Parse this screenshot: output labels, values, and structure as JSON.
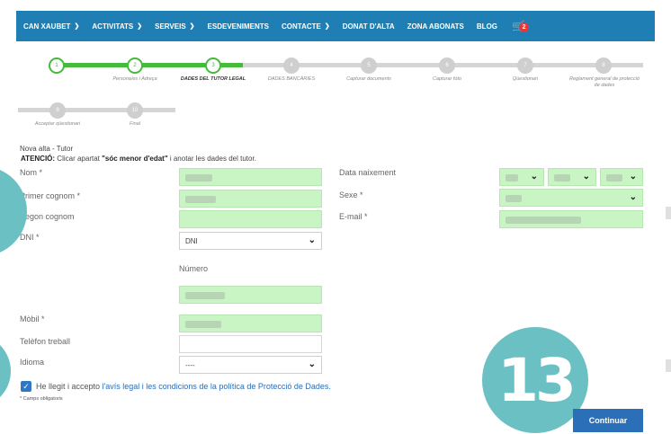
{
  "nav": {
    "items": [
      {
        "label": "CAN XAUBET",
        "dropdown": true
      },
      {
        "label": "ACTIVITATS",
        "dropdown": true
      },
      {
        "label": "SERVEIS",
        "dropdown": true
      },
      {
        "label": "ESDEVENIMENTS",
        "dropdown": false
      },
      {
        "label": "CONTACTE",
        "dropdown": true
      },
      {
        "label": "DONAT D'ALTA",
        "dropdown": false
      },
      {
        "label": "ZONA ABONATS",
        "dropdown": false
      },
      {
        "label": "BLOG",
        "dropdown": false
      }
    ],
    "cart_icon": "shopping-cart-icon",
    "cart_count": "2"
  },
  "steps": [
    {
      "number": "1",
      "label": "",
      "status": "done"
    },
    {
      "number": "2",
      "label": "Persona/es i Adreça",
      "status": "done"
    },
    {
      "number": "3",
      "label": "DADES DEL TUTOR LEGAL",
      "status": "active"
    },
    {
      "number": "4",
      "label": "DADES BANCÀRIES",
      "status": "todo"
    },
    {
      "number": "5",
      "label": "Capturar documents",
      "status": "todo"
    },
    {
      "number": "6",
      "label": "Capturar foto",
      "status": "todo"
    },
    {
      "number": "7",
      "label": "Qüestionari",
      "status": "todo"
    },
    {
      "number": "8",
      "label": "Reglament general de protecció de dades",
      "status": "todo"
    },
    {
      "number": "9",
      "label": "Acceptar qüestionari",
      "status": "todo"
    },
    {
      "number": "10",
      "label": "Final",
      "status": "todo"
    }
  ],
  "form": {
    "small_title": "Nova alta - Tutor",
    "atencio_prefix": "ATENCIÓ:",
    "atencio_text": " Clicar apartat ",
    "atencio_bold": "\"sóc menor d'edat\"",
    "atencio_suffix": " i anotar les dades del tutor.",
    "labels": {
      "nom": "Nom *",
      "primer_cognom": "Primer cognom *",
      "segon_cognom": "Segon cognom",
      "dni": "DNI *",
      "numero": "Número",
      "mobil": "Mòbil *",
      "telefon_treball": "Telèfon treball",
      "idioma": "Idioma",
      "data_naixement": "Data naixement",
      "sexe": "Sexe *",
      "email": "E-mail *"
    },
    "dni_type": "DNI",
    "idioma_value": "----",
    "legal_prefix": "He llegit i accepto ",
    "legal_link": "l'avís legal i les condicions de la política de Protecció de Dades.",
    "required_note": "* Camps obligatoris",
    "submit": "Continuar"
  },
  "overlays": {
    "marker_13": "13"
  },
  "colors": {
    "navbar": "#1f7fb4",
    "progress_done": "#44bb3a",
    "field_filled": "#c9f5c4",
    "button": "#2b6fb8",
    "overlay_circle": "#6bc0c3"
  }
}
